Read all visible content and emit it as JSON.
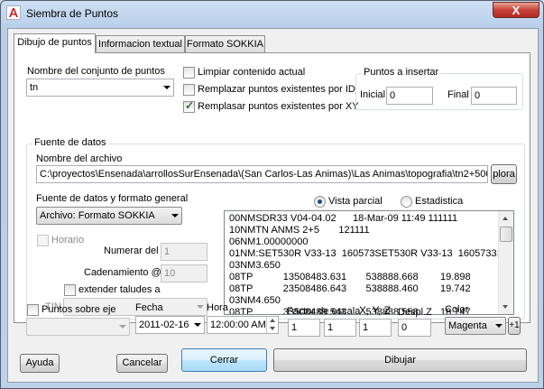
{
  "window": {
    "title": "Siembra de Puntos",
    "close_glyph": "X"
  },
  "tabs": [
    {
      "label": "Dibujo de puntos"
    },
    {
      "label": "Informacion textual"
    },
    {
      "label": "Formato SOKKIA"
    }
  ],
  "point_set": {
    "label": "Nombre del conjunto de puntos",
    "value": "tn"
  },
  "options": {
    "limpiar": {
      "label": "Limpiar contenido actual",
      "checked": false
    },
    "remplazar_id": {
      "label": "Remplazar puntos existentes por  ID",
      "checked": false
    },
    "remplasar_xy": {
      "label": "Remplasar puntos existentes por XY",
      "checked": true
    }
  },
  "insert": {
    "title": "Puntos a insertar",
    "initial_label": "Inicial",
    "initial_value": "0",
    "final_label": "Final",
    "final_value": "0"
  },
  "source": {
    "title": "Fuente de datos",
    "file_label": "Nombre del archivo",
    "file_path": "C:\\proyectos\\Ensenada\\arrollosSurEnsenada\\(San Carlos-Las Animas)\\Las Animas\\topografia\\tn2+500",
    "browse_label": "plora",
    "format_label": "Fuente de datos y formato general",
    "format_value": "Archivo: Formato SOKKIA",
    "vista_parcial": "Vista parcial",
    "estadistica": "Estadistica",
    "preview_lines": [
      "00NMSDR33 V04-04.02      18-Mar-09 11:49 111111",
      "10NMTN ANMS 2+5       121111",
      "06NM1.00000000",
      "01NM:SET530R V33-13  160573SET530R V33-13  16057331",
      "03NM3.650",
      "08TP           13508483.631       538888.668        19.898",
      "08TP           23508486.643       538888.460        19.742",
      "03NM4.650",
      "08TP           33508489.543       538888.558        18.747"
    ]
  },
  "horario": {
    "label": "Horario",
    "checked": false
  },
  "numerar": {
    "label": "Numerar del",
    "value": "1"
  },
  "cadenamiento": {
    "label": "Cadenamiento @",
    "value": "10"
  },
  "extender": {
    "label": "extender taludes a",
    "checked": false
  },
  "tin": {
    "label": "TIN",
    "value": ""
  },
  "bottom": {
    "puntos_eje_label": "Puntos sobre eje",
    "puntos_eje_value": "",
    "fecha_label": "Fecha",
    "fecha_value": "2011-02-16",
    "hora_label": "Hora",
    "hora_value": "12:00:00 AM",
    "factor_label": "Factor de escala",
    "xyz_label": "X, Y, Z",
    "factor_x": "1",
    "factor_y": "1",
    "factor_z": "1",
    "despl_label": "Despl.Z",
    "despl_value": "0",
    "color_label": "Color",
    "color_value": "Magenta",
    "plus_label": "+1"
  },
  "buttons": {
    "ayuda": "Ayuda",
    "cancelar": "Cancelar",
    "cerrar": "Cerrar",
    "dibujar": "Dibujar"
  },
  "colors": {
    "close_red": "#c7433a",
    "frame_blue": "#bcd1ea",
    "default_button": "#3c7fb1"
  }
}
